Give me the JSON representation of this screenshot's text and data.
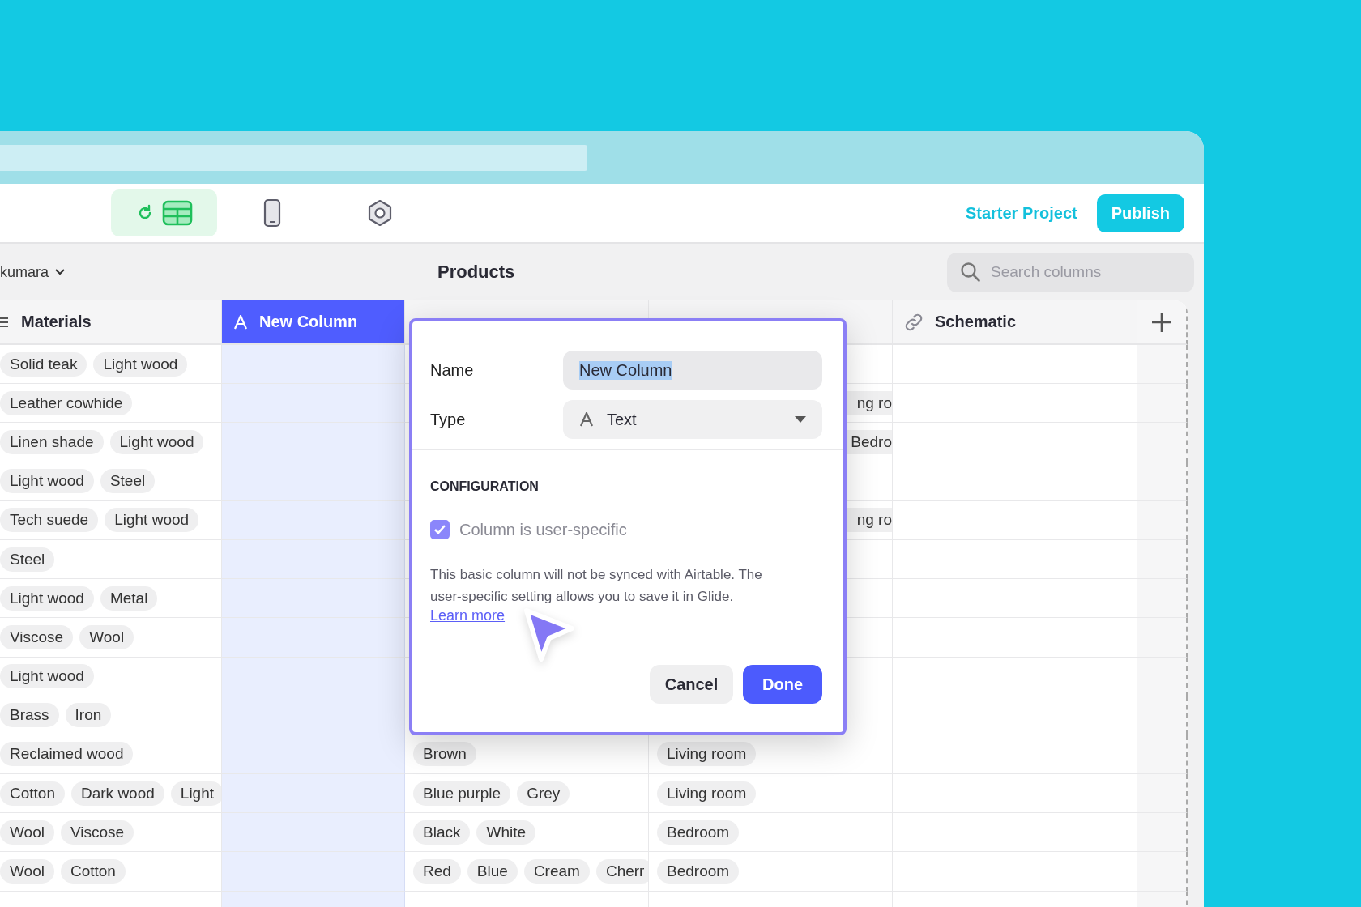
{
  "toolbar": {
    "tabs": [
      {
        "kind": "data",
        "selected": true
      },
      {
        "kind": "layout",
        "selected": false
      },
      {
        "kind": "settings",
        "selected": false
      }
    ],
    "project": "Starter Project",
    "publish": "Publish"
  },
  "subheader": {
    "user": "kumara",
    "title": "Products",
    "search": {
      "placeholder": "Search columns"
    }
  },
  "table": {
    "columns": [
      {
        "label": "Materials",
        "kind": "list",
        "selected": false
      },
      {
        "label": "New Column",
        "kind": "text",
        "selected": true
      },
      {
        "kind": "blank",
        "selected": false
      },
      {
        "kind": "blank",
        "selected": false
      },
      {
        "label": "Schematic",
        "kind": "link",
        "selected": false
      }
    ],
    "rows": [
      {
        "materials": [
          "Solid teak",
          "Light wood"
        ]
      },
      {
        "materials": [
          "Leather cowhide"
        ],
        "column_4": [
          "ng ro"
        ]
      },
      {
        "materials": [
          "Linen shade",
          "Light wood"
        ],
        "column_4": [
          "Bedro"
        ]
      },
      {
        "materials": [
          "Light wood",
          "Steel"
        ]
      },
      {
        "materials": [
          "Tech suede",
          "Light wood"
        ],
        "column_4": [
          "ng ro"
        ]
      },
      {
        "materials": [
          "Steel"
        ]
      },
      {
        "materials": [
          "Light wood",
          "Metal"
        ]
      },
      {
        "materials": [
          "Viscose",
          "Wool"
        ]
      },
      {
        "materials": [
          "Light wood"
        ]
      },
      {
        "materials": [
          "Brass",
          "Iron"
        ]
      },
      {
        "materials": [
          "Reclaimed wood"
        ],
        "column_3": [
          "Brown"
        ],
        "column_4": [
          "Living room"
        ]
      },
      {
        "materials": [
          "Cotton",
          "Dark wood",
          "Light"
        ],
        "column_3": [
          "Blue purple",
          "Grey"
        ],
        "column_4": [
          "Living room"
        ]
      },
      {
        "materials": [
          "Wool",
          "Viscose"
        ],
        "column_3": [
          "Black",
          "White"
        ],
        "column_4": [
          "Bedroom"
        ]
      },
      {
        "materials": [
          "Wool",
          "Cotton"
        ],
        "column_3": [
          "Red",
          "Blue",
          "Cream",
          "Cherr"
        ],
        "column_4": [
          "Bedroom"
        ]
      }
    ]
  },
  "dialog": {
    "name_label": "Name",
    "name_value": "New Column",
    "name_selected": true,
    "type_label": "Type",
    "type_value": "Text",
    "section": "CONFIGURATION",
    "checkbox": {
      "label": "Column is user-specific",
      "checked": true
    },
    "note": "This basic column will not be synced with Airtable. The user-specific setting allows you to save it in Glide.",
    "link": "Learn more",
    "buttons": [
      {
        "label": "Cancel",
        "kind": "secondary"
      },
      {
        "label": "Done",
        "kind": "primary"
      }
    ]
  }
}
